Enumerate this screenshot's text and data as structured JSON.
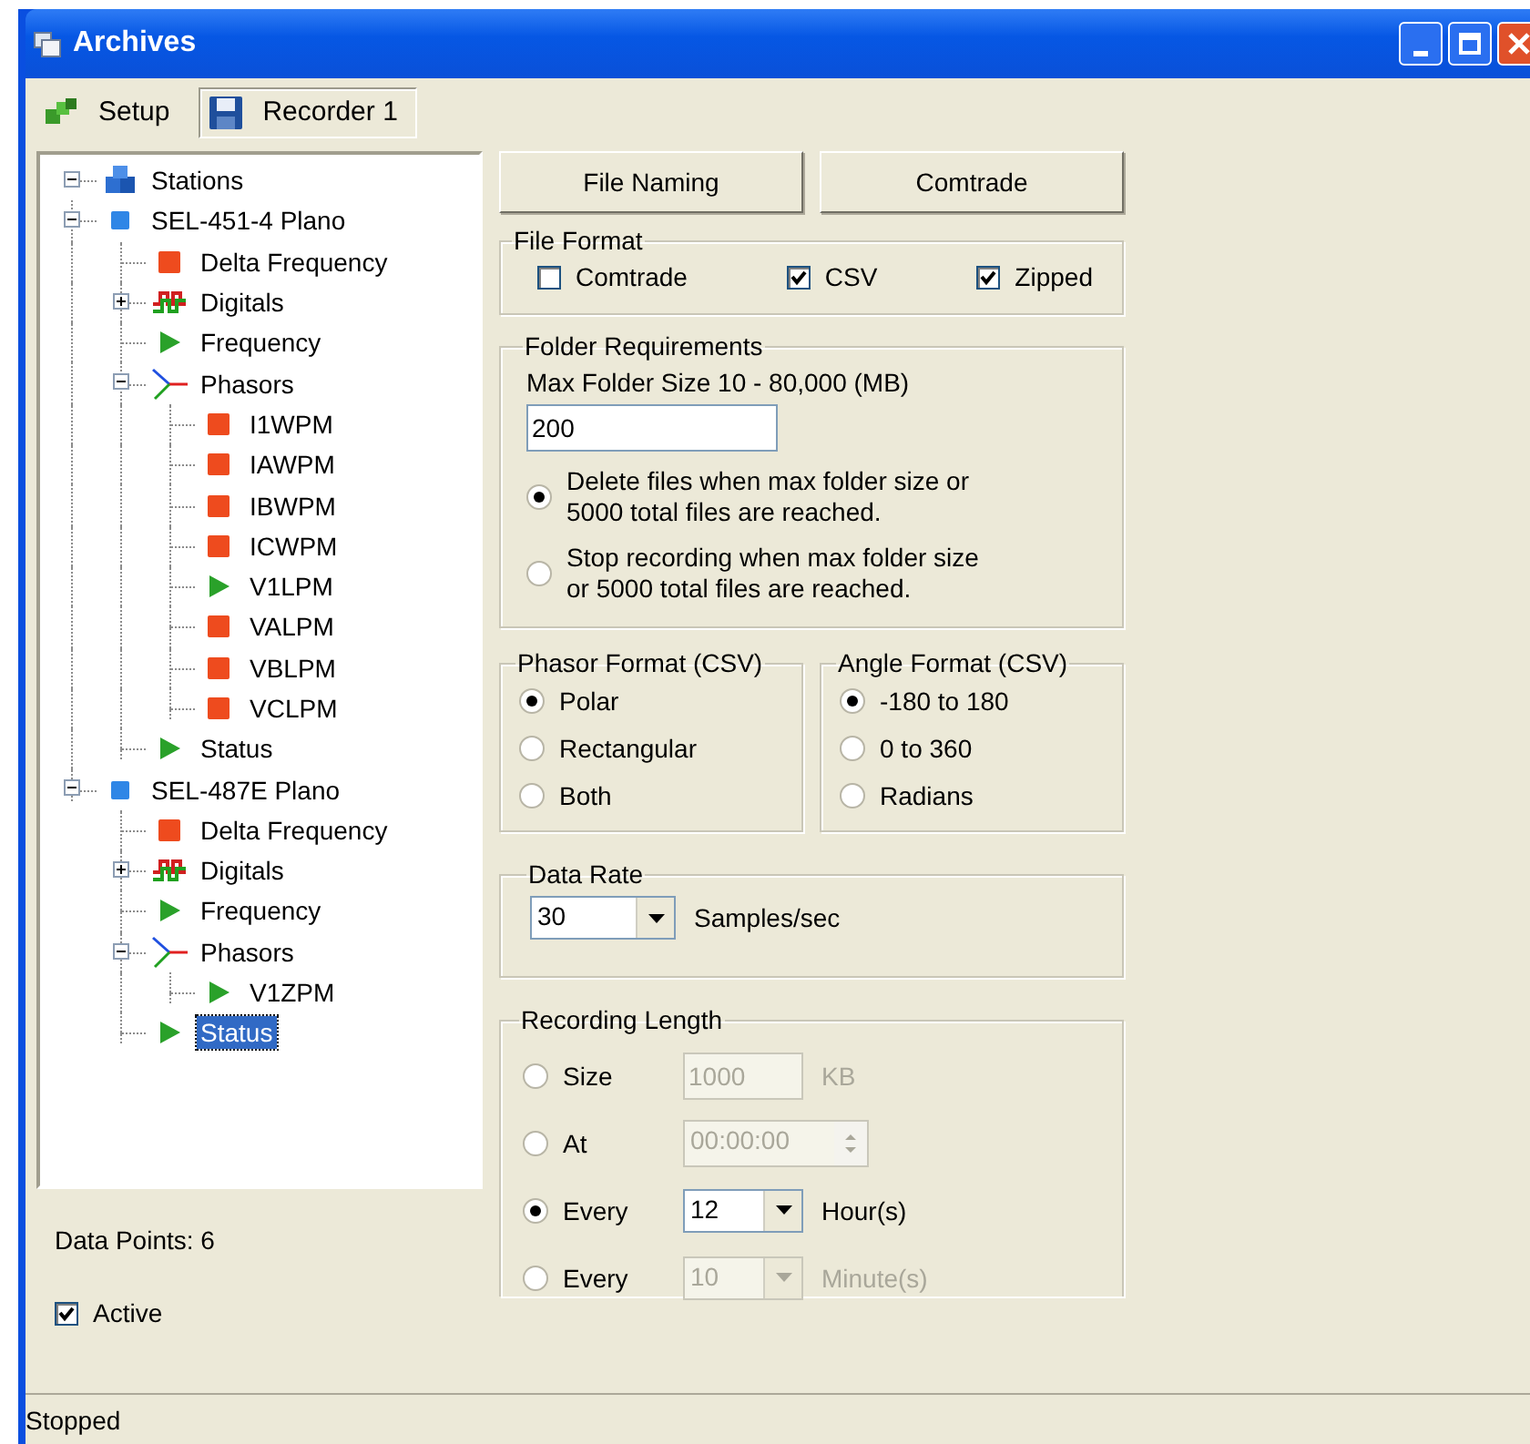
{
  "window": {
    "title": "Archives"
  },
  "tabs": [
    {
      "label": "Setup",
      "kind": "setup",
      "selected": false
    },
    {
      "label": "Recorder 1",
      "kind": "recorder",
      "selected": true
    }
  ],
  "tree": {
    "nodes": [
      {
        "label": "Stations",
        "kind": "stations",
        "selected": false,
        "expanded": true,
        "children": [
          {
            "label": "SEL-451-4 Plano",
            "kind": "device",
            "selected": false,
            "expanded": true,
            "children": [
              {
                "label": "Delta Frequency",
                "kind": "square",
                "selected": false
              },
              {
                "label": "Digitals",
                "kind": "digitals",
                "selected": false,
                "expanded": false
              },
              {
                "label": "Frequency",
                "kind": "arrow",
                "selected": false
              },
              {
                "label": "Phasors",
                "kind": "phasors",
                "selected": false,
                "expanded": true,
                "children": [
                  {
                    "label": "I1WPM",
                    "kind": "square",
                    "selected": false
                  },
                  {
                    "label": "IAWPM",
                    "kind": "square",
                    "selected": false
                  },
                  {
                    "label": "IBWPM",
                    "kind": "square",
                    "selected": false
                  },
                  {
                    "label": "ICWPM",
                    "kind": "square",
                    "selected": false
                  },
                  {
                    "label": "V1LPM",
                    "kind": "arrow",
                    "selected": false
                  },
                  {
                    "label": "VALPM",
                    "kind": "square",
                    "selected": false
                  },
                  {
                    "label": "VBLPM",
                    "kind": "square",
                    "selected": false
                  },
                  {
                    "label": "VCLPM",
                    "kind": "square",
                    "selected": false
                  }
                ]
              },
              {
                "label": "Status",
                "kind": "arrow",
                "selected": false
              }
            ]
          },
          {
            "label": "SEL-487E Plano",
            "kind": "device",
            "selected": false,
            "expanded": true,
            "children": [
              {
                "label": "Delta Frequency",
                "kind": "square",
                "selected": false
              },
              {
                "label": "Digitals",
                "kind": "digitals",
                "selected": false,
                "expanded": false
              },
              {
                "label": "Frequency",
                "kind": "arrow",
                "selected": false
              },
              {
                "label": "Phasors",
                "kind": "phasors",
                "selected": false,
                "expanded": true,
                "children": [
                  {
                    "label": "V1ZPM",
                    "kind": "arrow",
                    "selected": false
                  }
                ]
              },
              {
                "label": "Status",
                "kind": "arrow",
                "selected": true
              }
            ]
          }
        ]
      }
    ]
  },
  "data_points": "Data Points:  6",
  "active": {
    "label": "Active",
    "checked": true
  },
  "buttons": [
    "File Naming",
    "Comtrade"
  ],
  "file_format": {
    "title": "File Format",
    "options": [
      {
        "label": "Comtrade",
        "checked": false
      },
      {
        "label": "CSV",
        "checked": true
      },
      {
        "label": "Zipped",
        "checked": true
      }
    ]
  },
  "folder_requirements": {
    "title": "Folder Requirements",
    "size_label": "Max Folder Size 10 - 80,000 (MB)",
    "size_value": "200",
    "options": [
      {
        "label": "Delete files when max folder size or 5000 total files are reached.",
        "selected": true
      },
      {
        "label": "Stop recording when max folder size or 5000 total files are reached.",
        "selected": false
      }
    ]
  },
  "phasor_format": {
    "title": "Phasor Format (CSV)",
    "options": [
      {
        "label": "Polar",
        "selected": true
      },
      {
        "label": "Rectangular",
        "selected": false
      },
      {
        "label": "Both",
        "selected": false
      }
    ]
  },
  "angle_format": {
    "title": "Angle Format (CSV)",
    "options": [
      {
        "label": "-180 to 180",
        "selected": true
      },
      {
        "label": "0 to 360",
        "selected": false
      },
      {
        "label": "Radians",
        "selected": false
      }
    ]
  },
  "data_rate": {
    "title": "Data Rate",
    "value": "30",
    "unit": "Samples/sec"
  },
  "recording_length": {
    "title": "Recording Length",
    "rows": [
      {
        "kind": "field",
        "label": "Size",
        "selected": false,
        "value": "1000",
        "unit": "KB",
        "disabled": true
      },
      {
        "kind": "spinner",
        "label": "At",
        "selected": false,
        "value": "00:00:00",
        "disabled": true
      },
      {
        "kind": "dropdown",
        "label": "Every",
        "selected": true,
        "value": "12",
        "unit": "Hour(s)",
        "disabled": false
      },
      {
        "kind": "dropdown",
        "label": "Every",
        "selected": false,
        "value": "10",
        "unit": "Minute(s)",
        "disabled": true
      }
    ]
  },
  "status_bar": "Stopped"
}
